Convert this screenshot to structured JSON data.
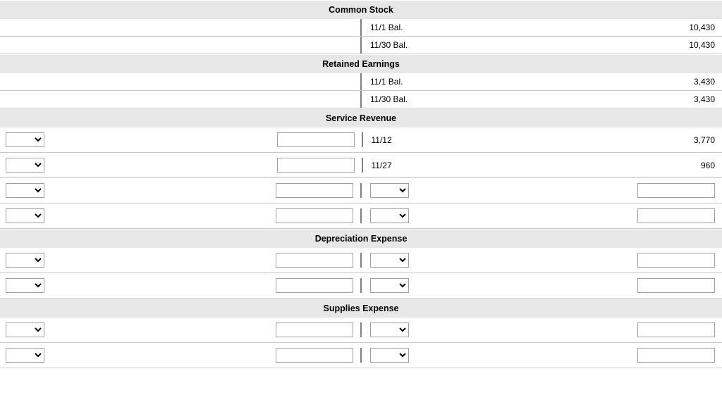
{
  "accounts": [
    {
      "name": "Common Stock",
      "rows": [
        {
          "type": "static",
          "right_date": "11/1 Bal.",
          "right_amt": "10,430"
        },
        {
          "type": "static",
          "right_date": "11/30 Bal.",
          "right_amt": "10,430"
        }
      ]
    },
    {
      "name": "Retained Earnings",
      "rows": [
        {
          "type": "static",
          "right_date": "11/1 Bal.",
          "right_amt": "3,430"
        },
        {
          "type": "static",
          "right_date": "11/30 Bal.",
          "right_amt": "3,430"
        }
      ]
    },
    {
      "name": "Service Revenue",
      "rows": [
        {
          "type": "mixed",
          "right_date": "11/12",
          "right_amt": "3,770"
        },
        {
          "type": "mixed",
          "right_date": "11/27",
          "right_amt": "960"
        },
        {
          "type": "inputs"
        },
        {
          "type": "inputs"
        }
      ]
    },
    {
      "name": "Depreciation Expense",
      "rows": [
        {
          "type": "inputs"
        },
        {
          "type": "inputs"
        }
      ]
    },
    {
      "name": "Supplies Expense",
      "rows": [
        {
          "type": "inputs"
        },
        {
          "type": "inputs"
        }
      ]
    }
  ]
}
